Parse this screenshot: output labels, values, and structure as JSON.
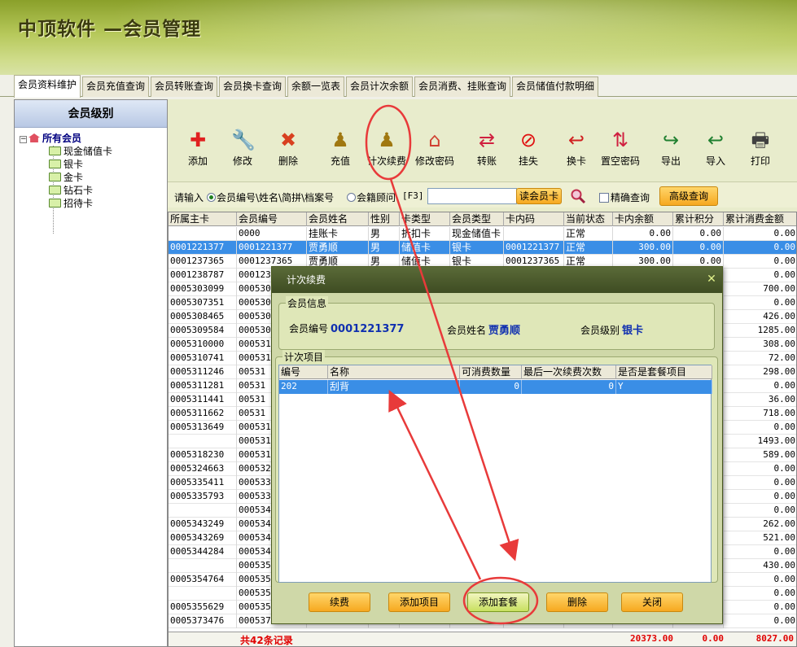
{
  "app": {
    "title": "中顶软件 —会员管理"
  },
  "tabs": [
    "会员资料维护",
    "会员充值查询",
    "会员转账查询",
    "会员换卡查询",
    "余额一览表",
    "会员计次余额",
    "会员消费、挂账查询",
    "会员储值付款明细"
  ],
  "sidebar": {
    "header": "会员级别",
    "root": "所有会员",
    "expander": "−",
    "items": [
      "现金储值卡",
      "银卡",
      "金卡",
      "钻石卡",
      "招待卡"
    ]
  },
  "toolbar": {
    "buttons": [
      {
        "label": "添加",
        "icon": "plus-icon",
        "glyph": "✚",
        "color": "#e02020"
      },
      {
        "label": "修改",
        "icon": "wrench-icon",
        "glyph": "🔧",
        "color": "#505060"
      },
      {
        "label": "删除",
        "icon": "delete-x-icon",
        "glyph": "✖",
        "color": "#d84020"
      },
      {
        "label": "充值",
        "icon": "pawn-icon",
        "glyph": "♟",
        "color": "#a07810"
      },
      {
        "label": "计次续费",
        "icon": "pawn-icon",
        "glyph": "♟",
        "color": "#a07810"
      },
      {
        "label": "修改密码",
        "icon": "house-key-icon",
        "glyph": "⌂",
        "color": "#d04030"
      },
      {
        "label": "转账",
        "icon": "transfer-arrows-icon",
        "glyph": "⇄",
        "color": "#d02040"
      },
      {
        "label": "挂失",
        "icon": "no-entry-icon",
        "glyph": "⊘",
        "color": "#e01010"
      },
      {
        "label": "换卡",
        "icon": "swap-arrow-icon",
        "glyph": "↩",
        "color": "#d02020"
      },
      {
        "label": "置空密码",
        "icon": "reset-arrows-icon",
        "glyph": "⇅",
        "color": "#d02040"
      },
      {
        "label": "导出",
        "icon": "export-excel-icon",
        "glyph": "↪",
        "color": "#208030"
      },
      {
        "label": "导入",
        "icon": "import-excel-icon",
        "glyph": "↩",
        "color": "#208030"
      },
      {
        "label": "打印",
        "icon": "printer-icon",
        "glyph": "🖶",
        "color": "#404040"
      }
    ]
  },
  "search": {
    "prompt": "请输入",
    "option1": "会员编号\\姓名\\简拼\\档案号",
    "option2": "会籍顾问",
    "hotkey": "[F3]",
    "value": "",
    "read_card": "读会员卡",
    "exact": "精确查询",
    "advanced": "高级查询"
  },
  "grid": {
    "columns": [
      "所属主卡",
      "会员编号",
      "会员姓名",
      "性别",
      "卡类型",
      "会员类型",
      "卡内码",
      "当前状态",
      "卡内余额",
      "累计积分",
      "累计消费金额"
    ],
    "rows": [
      [
        "",
        "0000",
        "挂账卡",
        "男",
        "折扣卡",
        "现金储值卡",
        "",
        "正常",
        "0.00",
        "0.00",
        "0.00"
      ],
      [
        "0001221377",
        "0001221377",
        "贾勇顺",
        "男",
        "储值卡",
        "银卡",
        "0001221377",
        "正常",
        "300.00",
        "0.00",
        "0.00"
      ],
      [
        "0001237365",
        "0001237365",
        "贾勇顺",
        "男",
        "储值卡",
        "银卡",
        "0001237365",
        "正常",
        "300.00",
        "0.00",
        "0.00"
      ],
      [
        "0001238787",
        "000123",
        "",
        "",
        "",
        "",
        "",
        "",
        "",
        "",
        "0.00"
      ],
      [
        "0005303099",
        "000530",
        "",
        "",
        "",
        "",
        "",
        "",
        "",
        "",
        "700.00"
      ],
      [
        "0005307351",
        "000530",
        "",
        "",
        "",
        "",
        "",
        "",
        "",
        "",
        "0.00"
      ],
      [
        "0005308465",
        "000530",
        "",
        "",
        "",
        "",
        "",
        "",
        "",
        "",
        "426.00"
      ],
      [
        "0005309584",
        "000530",
        "",
        "",
        "",
        "",
        "",
        "",
        "",
        "",
        "1285.00"
      ],
      [
        "0005310000",
        "000531",
        "",
        "",
        "",
        "",
        "",
        "",
        "",
        "",
        "308.00"
      ],
      [
        "0005310741",
        "000531",
        "",
        "",
        "",
        "",
        "",
        "",
        "",
        "",
        "72.00"
      ],
      [
        "0005311246",
        "00531",
        "",
        "",
        "",
        "",
        "",
        "",
        "",
        "",
        "298.00"
      ],
      [
        "0005311281",
        "00531",
        "",
        "",
        "",
        "",
        "",
        "",
        "",
        "",
        "0.00"
      ],
      [
        "0005311441",
        "00531",
        "",
        "",
        "",
        "",
        "",
        "",
        "",
        "",
        "36.00"
      ],
      [
        "0005311662",
        "00531",
        "",
        "",
        "",
        "",
        "",
        "",
        "",
        "",
        "718.00"
      ],
      [
        "0005313649",
        "000531",
        "",
        "",
        "",
        "",
        "",
        "",
        "",
        "",
        "0.00"
      ],
      [
        "",
        "000531",
        "",
        "",
        "",
        "",
        "",
        "",
        "",
        "",
        "1493.00"
      ],
      [
        "0005318230",
        "000531",
        "",
        "",
        "",
        "",
        "",
        "",
        "",
        "",
        "589.00"
      ],
      [
        "0005324663",
        "000532",
        "",
        "",
        "",
        "",
        "",
        "",
        "",
        "",
        "0.00"
      ],
      [
        "0005335411",
        "000533",
        "",
        "",
        "",
        "",
        "",
        "",
        "",
        "",
        "0.00"
      ],
      [
        "0005335793",
        "000533",
        "",
        "",
        "",
        "",
        "",
        "",
        "",
        "",
        "0.00"
      ],
      [
        "",
        "000534",
        "",
        "",
        "",
        "",
        "",
        "",
        "",
        "",
        "0.00"
      ],
      [
        "0005343249",
        "000534",
        "",
        "",
        "",
        "",
        "",
        "",
        "",
        "",
        "262.00"
      ],
      [
        "0005343269",
        "000534",
        "",
        "",
        "",
        "",
        "",
        "",
        "",
        "",
        "521.00"
      ],
      [
        "0005344284",
        "000534",
        "",
        "",
        "",
        "",
        "",
        "",
        "",
        "",
        "0.00"
      ],
      [
        "",
        "000535",
        "",
        "",
        "",
        "",
        "",
        "",
        "",
        "",
        "430.00"
      ],
      [
        "0005354764",
        "000535",
        "",
        "",
        "",
        "",
        "",
        "",
        "",
        "",
        "0.00"
      ],
      [
        "",
        "000535",
        "",
        "",
        "",
        "",
        "",
        "",
        "",
        "",
        "0.00"
      ],
      [
        "0005355629",
        "000535",
        "",
        "",
        "",
        "",
        "",
        "",
        "",
        "",
        "0.00"
      ],
      [
        "0005373476",
        "000537",
        "",
        "",
        "",
        "",
        "",
        "",
        "",
        "",
        "0.00"
      ]
    ],
    "selected_row": 1,
    "total_label": "共42条记录",
    "total_balance": "20373.00",
    "total_points": "0.00",
    "total_spend": "8027.00"
  },
  "dialog": {
    "title": "计次续费",
    "close_glyph": "✕",
    "info_group": "会员信息",
    "member_no_label": "会员编号",
    "member_no": "0001221377",
    "member_name_label": "会员姓名",
    "member_name": "贾勇顺",
    "member_level_label": "会员级别",
    "member_level": "银卡",
    "items_group": "计次项目",
    "columns": [
      "编号",
      "名称",
      "可消费数量",
      "最后一次续费次数",
      "是否是套餐项目"
    ],
    "rows": [
      [
        "202",
        "刮背",
        "0",
        "0",
        "Y"
      ]
    ],
    "buttons": [
      "续费",
      "添加项目",
      "添加套餐",
      "删除",
      "关闭"
    ]
  },
  "colors": {
    "selection": "#3a8ee6",
    "annotation": "#e83a3a",
    "accent_button": "#f6a820",
    "dialog_title": "#3e4c22"
  }
}
